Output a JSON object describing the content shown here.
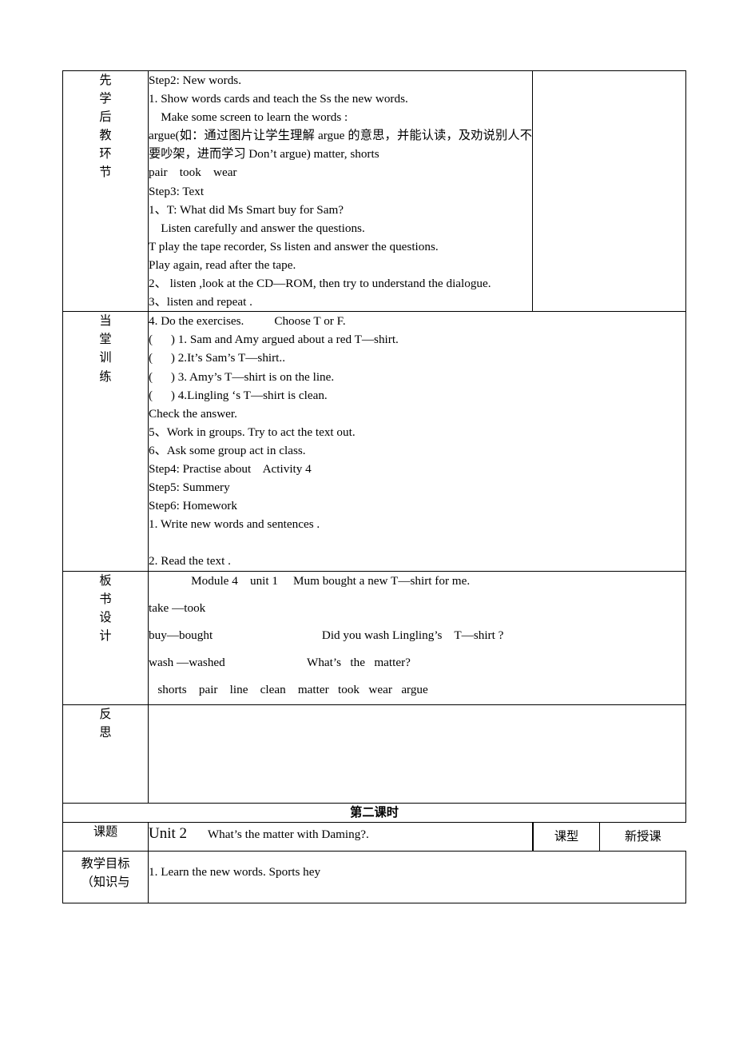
{
  "document": {
    "type": "lesson-plan-table"
  },
  "rows": {
    "pre_teach": {
      "label_chars": [
        "先",
        "学",
        "后",
        "教",
        "环",
        "节"
      ],
      "lines": [
        "Step2: New words.",
        "1. Show words cards and teach the Ss the new words.",
        "    Make some screen to learn the words :",
        "argue(如：通过图片让学生理解 argue 的意思，并能认读，及劝说别人不要吵架，进而学习 Don’t argue) matter, shorts",
        "pair    took    wear",
        "Step3: Text",
        "1、T: What did Ms Smart buy for Sam?",
        "    Listen carefully and answer the questions.",
        "T play the tape recorder, Ss listen and answer the questions.",
        "Play again, read after the tape.",
        "2、 listen ,look at the CD—ROM, then try to understand the dialogue.",
        "3、listen and repeat ."
      ],
      "side": ""
    },
    "practice": {
      "label_chars": [
        "当",
        "堂",
        "训",
        "练"
      ],
      "lines": [
        "4. Do the exercises.          Choose T or F.",
        "(      ) 1. Sam and Amy argued about a red T—shirt.",
        "(      ) 2.It’s Sam’s T—shirt..",
        "(      ) 3. Amy’s T—shirt is on the line.",
        "(      ) 4.Lingling ‘s T—shirt is clean.",
        "Check the answer.",
        "5、Work in groups. Try to act the text out.",
        "6、Ask some group act in class.",
        "Step4: Practise about    Activity 4",
        "Step5: Summery",
        "Step6: Homework",
        "1. Write new words and sentences .",
        "",
        "2. Read the text ."
      ]
    },
    "board_design": {
      "label_chars": [
        "板",
        "书",
        "设",
        "计"
      ],
      "lines": [
        "              Module 4    unit 1     Mum bought a new T—shirt for me.",
        "take —took",
        "buy—bought                                    Did you wash Lingling’s    T—shirt ?",
        "wash —washed                           What’s   the   matter?",
        "   shorts    pair    line    clean    matter   took   wear   argue"
      ]
    },
    "reflection": {
      "label_chars": [
        "反",
        "思"
      ],
      "content": ""
    },
    "second_lesson_heading": "第二课时",
    "topic_row": {
      "label": "课题",
      "value_prefix": "Unit 2",
      "value_rest": "What’s the matter    with Daming?.",
      "type_label": "课型",
      "type_value": "新授课"
    },
    "objectives_row": {
      "label_line1": "教学目标",
      "label_line2": "（知识与",
      "content": "1.  Learn the new words. Sports    hey"
    }
  }
}
